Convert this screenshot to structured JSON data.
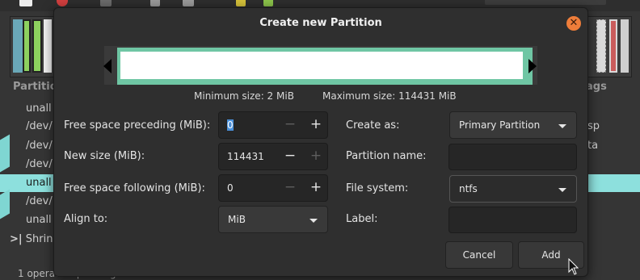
{
  "dialog": {
    "title": "Create new Partition",
    "close_symbol": "✕",
    "minimum_size": "Minimum size: 2 MiB",
    "maximum_size": "Maximum size: 114431 MiB"
  },
  "fields": {
    "free_preceding": {
      "label": "Free space preceding (MiB):",
      "value": "0"
    },
    "new_size": {
      "label": "New size (MiB):",
      "value": "114431"
    },
    "free_following": {
      "label": "Free space following (MiB):",
      "value": "0"
    },
    "align_to": {
      "label": "Align to:",
      "value": "MiB"
    },
    "create_as": {
      "label": "Create as:",
      "value": "Primary Partition"
    },
    "partition_name": {
      "label": "Partition name:",
      "value": ""
    },
    "file_system": {
      "label": "File system:",
      "value": "ntfs"
    },
    "volume_label": {
      "label": "Label:",
      "value": ""
    }
  },
  "spin_symbols": {
    "minus": "−",
    "plus": "+"
  },
  "buttons": {
    "cancel": "Cancel",
    "add": "Add"
  },
  "background": {
    "left_header": "Partitio",
    "right_header": "ags",
    "rows": [
      {
        "left": "unall",
        "right": ""
      },
      {
        "left": "/dev/",
        "right": "sp"
      },
      {
        "left": "/dev/",
        "right": "ta"
      },
      {
        "left": "/dev/",
        "right": ""
      },
      {
        "left": "unall",
        "right": ""
      },
      {
        "left": "/dev/",
        "right": ""
      },
      {
        "left": "unall",
        "right": ""
      }
    ],
    "shrink_label": "Shrin",
    "status": "1 operation pending"
  },
  "colors": {
    "accent": "#ee7d3a",
    "partition_fill": "#6fc6a4",
    "selected_row": "#8de0dd"
  }
}
